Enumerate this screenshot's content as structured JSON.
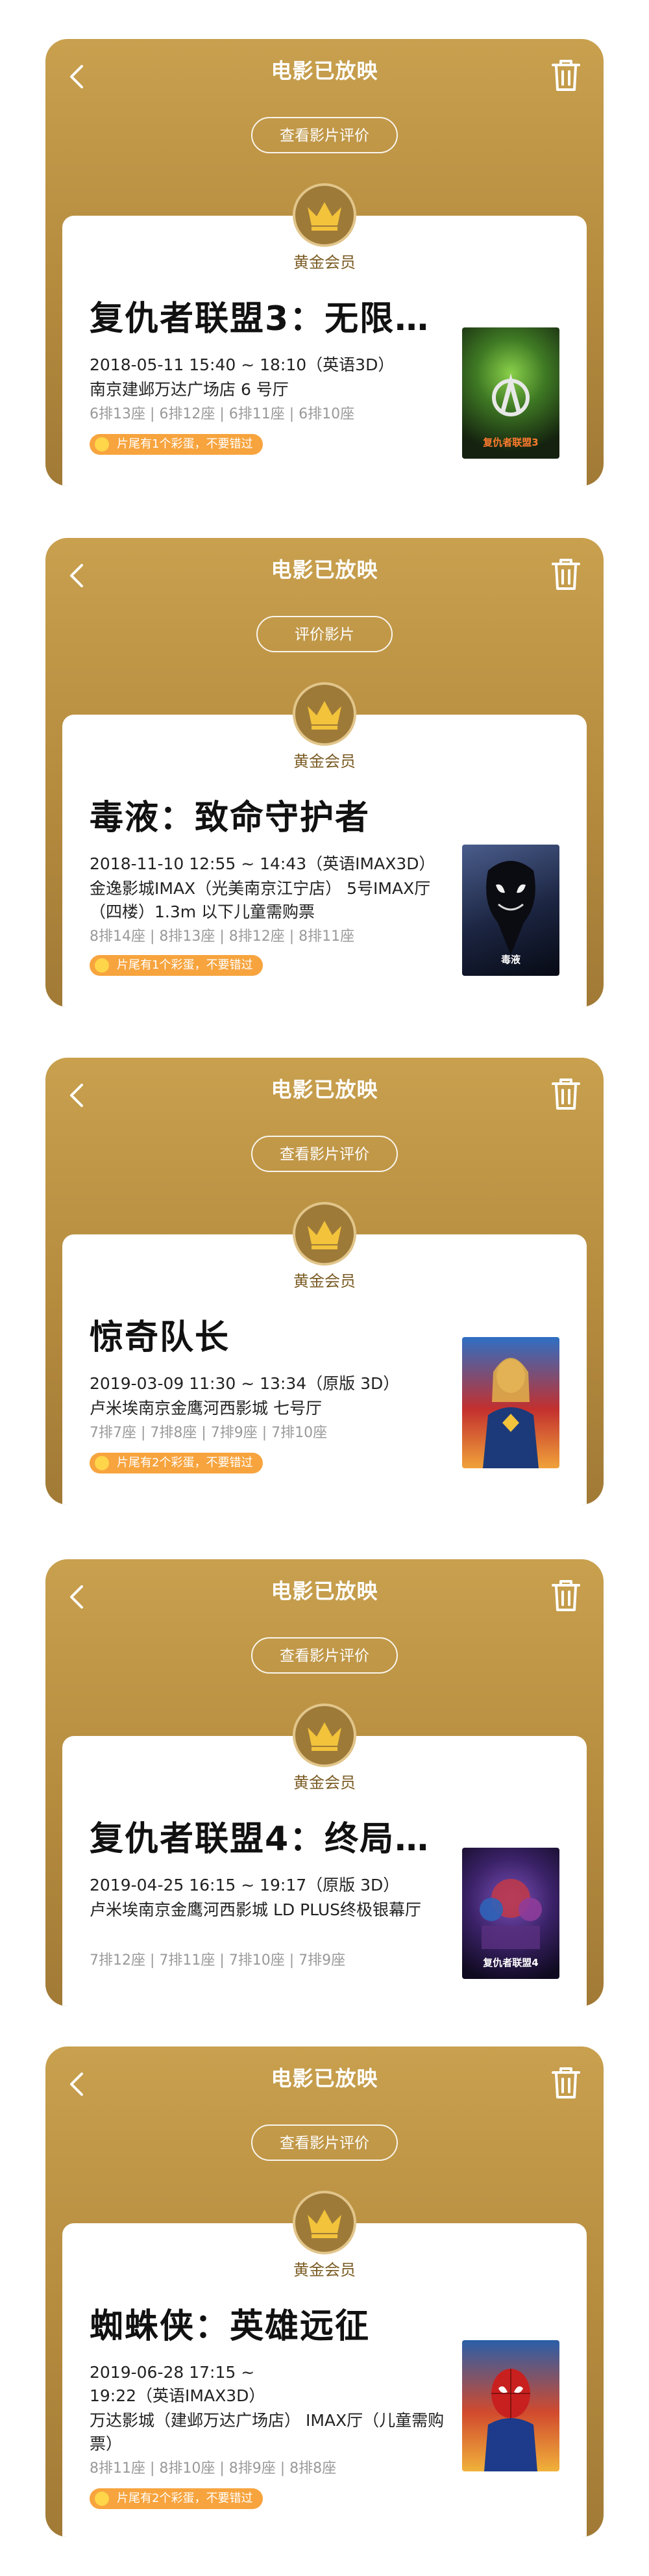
{
  "cards": [
    {
      "header_title": "电影已放映",
      "pill_label": "查看影片评价",
      "tier": "黄金会员",
      "movie_title": "复仇者联盟3：无限…",
      "showtime": "2018-05-11 15:40 ~ 18:10（英语3D）",
      "cinema": "南京建邺万达广场店 6 号厅",
      "seats": "6排13座 | 6排12座 | 6排11座 | 6排10座",
      "egg": "片尾有1个彩蛋，不要错过",
      "poster_icon": "avengers-infinity-war-poster",
      "poster_label": "复仇者联盟3"
    },
    {
      "header_title": "电影已放映",
      "pill_label": "评价影片",
      "tier": "黄金会员",
      "movie_title": "毒液：致命守护者",
      "showtime": "2018-11-10 12:55 ~ 14:43（英语IMAX3D）",
      "cinema": "金逸影城IMAX（光美南京江宁店） 5号IMAX厅（四楼）1.3m 以下儿童需购票",
      "seats": "8排14座 | 8排13座 | 8排12座 | 8排11座",
      "egg": "片尾有1个彩蛋，不要错过",
      "poster_icon": "venom-poster",
      "poster_label": "毒液"
    },
    {
      "header_title": "电影已放映",
      "pill_label": "查看影片评价",
      "tier": "黄金会员",
      "movie_title": "惊奇队长",
      "showtime": "2019-03-09 11:30 ~ 13:34（原版 3D）",
      "cinema": "卢米埃南京金鹰河西影城 七号厅",
      "seats": "7排7座 | 7排8座 | 7排9座 | 7排10座",
      "egg": "片尾有2个彩蛋，不要错过",
      "poster_icon": "captain-marvel-poster",
      "poster_label": ""
    },
    {
      "header_title": "电影已放映",
      "pill_label": "查看影片评价",
      "tier": "黄金会员",
      "movie_title": "复仇者联盟4：终局…",
      "showtime": "2019-04-25 16:15 ~ 19:17（原版 3D）",
      "cinema": "卢米埃南京金鹰河西影城 LD PLUS终极银幕厅",
      "seats": "7排12座 | 7排11座 | 7排10座 | 7排9座",
      "egg": "",
      "poster_icon": "avengers-endgame-poster",
      "poster_label": "复仇者联盟4"
    },
    {
      "header_title": "电影已放映",
      "pill_label": "查看影片评价",
      "tier": "黄金会员",
      "movie_title": "蜘蛛侠：英雄远征",
      "showtime": "2019-06-28 17:15 ~ 19:22（英语IMAX3D）",
      "cinema": "万达影城（建邺万达广场店） IMAX厅（儿童需购票）",
      "seats": "8排11座 | 8排10座 | 8排9座 | 8排8座",
      "egg": "片尾有2个彩蛋，不要错过",
      "poster_icon": "spider-man-far-from-home-poster",
      "poster_label": ""
    }
  ]
}
